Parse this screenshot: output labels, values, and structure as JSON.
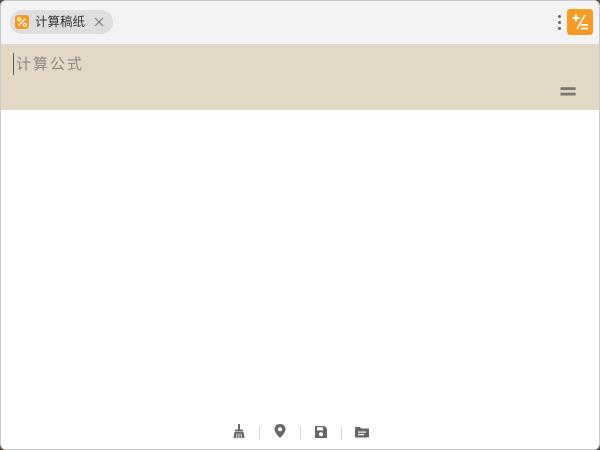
{
  "tab": {
    "label": "计算稿纸",
    "icon": "percent-icon"
  },
  "header": {
    "menu_icon": "more-vertical-icon",
    "app_icon": "plus-minus-icon"
  },
  "formula": {
    "placeholder": "计算公式",
    "value": "",
    "equals_label": "="
  },
  "toolbar": {
    "items": [
      {
        "name": "clear",
        "icon": "broom-icon"
      },
      {
        "name": "pin",
        "icon": "location-pin-icon"
      },
      {
        "name": "save",
        "icon": "floppy-disk-icon"
      },
      {
        "name": "open",
        "icon": "folder-icon"
      }
    ]
  },
  "colors": {
    "accent": "#f59a23",
    "formula_bg": "#e2d8c5",
    "tabbar_bg": "#f3f3f3",
    "icon_gray": "#666666"
  }
}
